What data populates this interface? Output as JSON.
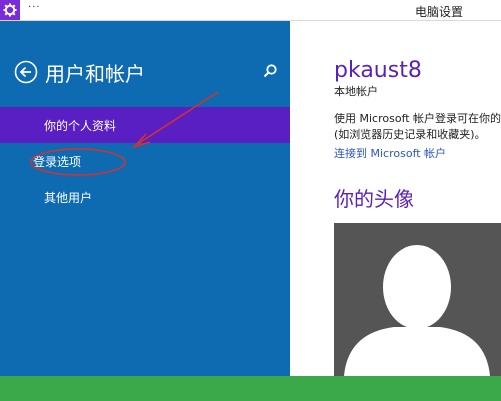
{
  "window": {
    "title": "电脑设置",
    "menu_glyph": "···"
  },
  "sidebar": {
    "heading": "用户和帐户",
    "items": [
      {
        "label": "你的个人资料",
        "selected": true
      },
      {
        "label": "登录选项",
        "selected": false
      },
      {
        "label": "其他用户",
        "selected": false
      }
    ]
  },
  "account": {
    "name": "pkaust8",
    "type": "本地帐户",
    "description_line1": "使用 Microsoft 帐户登录可在你的所",
    "description_line2": "(如浏览器历史记录和收藏夹)。",
    "connect_link": "连接到 Microsoft 帐户",
    "avatar_heading": "你的头像"
  },
  "icons": {
    "app": "settings-gear-icon",
    "back": "back-arrow-icon",
    "search": "search-icon",
    "avatar": "person-silhouette-icon"
  },
  "colors": {
    "sidebar": "#0f6bb1",
    "selected": "#5a1fc2",
    "accent_text": "#5b1fbd",
    "link": "#2a56c6",
    "bottom_bar": "#3ba94a",
    "annotation": "#d9302c"
  }
}
